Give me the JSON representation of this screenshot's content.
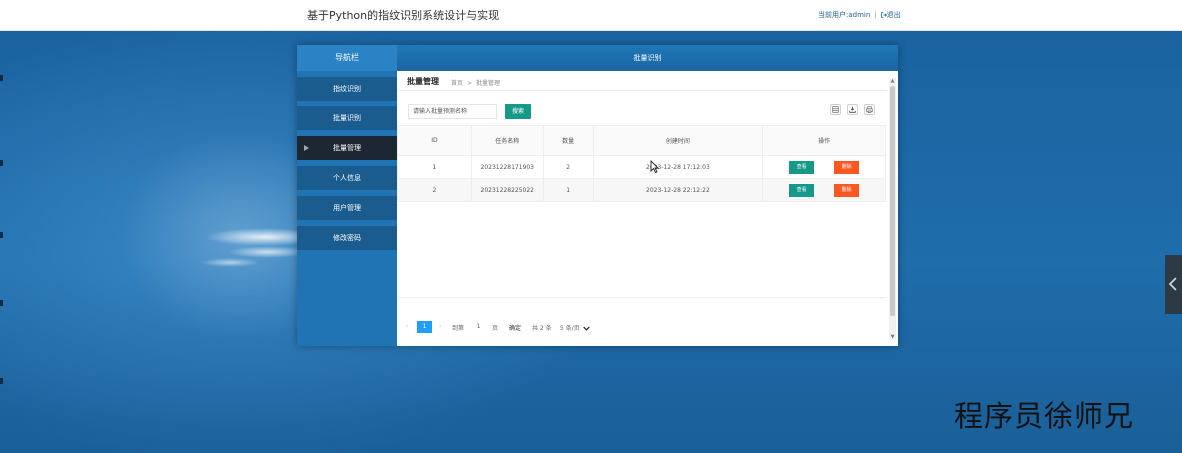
{
  "header": {
    "site_title": "基于Python的指纹识别系统设计与实现",
    "current_user": "当前用户:admin",
    "separator": "|",
    "logout": "退出"
  },
  "sidebar": {
    "title": "导航栏",
    "items": [
      {
        "label": "指纹识别"
      },
      {
        "label": "批量识别"
      },
      {
        "label": "批量管理",
        "active": true
      },
      {
        "label": "个人信息"
      },
      {
        "label": "用户管理"
      },
      {
        "label": "修改密码"
      }
    ]
  },
  "main": {
    "header_title": "批量识别",
    "page_heading": "批量管理",
    "breadcrumb": [
      "首页",
      ">",
      "批量管理"
    ],
    "search": {
      "placeholder": "请输入批量预测名称",
      "button": "搜索"
    },
    "toolbar_icons": [
      "columns-icon",
      "export-icon",
      "print-icon"
    ],
    "table": {
      "columns": [
        "ID",
        "任务名称",
        "数量",
        "创建时间",
        "操作"
      ],
      "rows": [
        {
          "id": "1",
          "name": "20231228171903",
          "count": "2",
          "created": "2023-12-28 17:12:03",
          "view": "查看",
          "delete": "删除"
        },
        {
          "id": "2",
          "name": "20231228225022",
          "count": "1",
          "created": "2023-12-28 22:12:22",
          "view": "查看",
          "delete": "删除"
        }
      ]
    },
    "pagination": {
      "current_page": "1",
      "goto_label": "到第",
      "goto_value": "1",
      "page_unit": "页",
      "confirm": "确定",
      "total": "共 2 条",
      "per_page": "5 条/页"
    }
  },
  "watermark": "程序员徐师兄",
  "colors": {
    "primary_teal": "#17998a",
    "danger_orange": "#ff5722",
    "page_active_blue": "#1e9fff",
    "sidebar_blue": "#2074b4",
    "sidebar_active": "#1d2633",
    "background_blue": "#1e6aa8"
  }
}
